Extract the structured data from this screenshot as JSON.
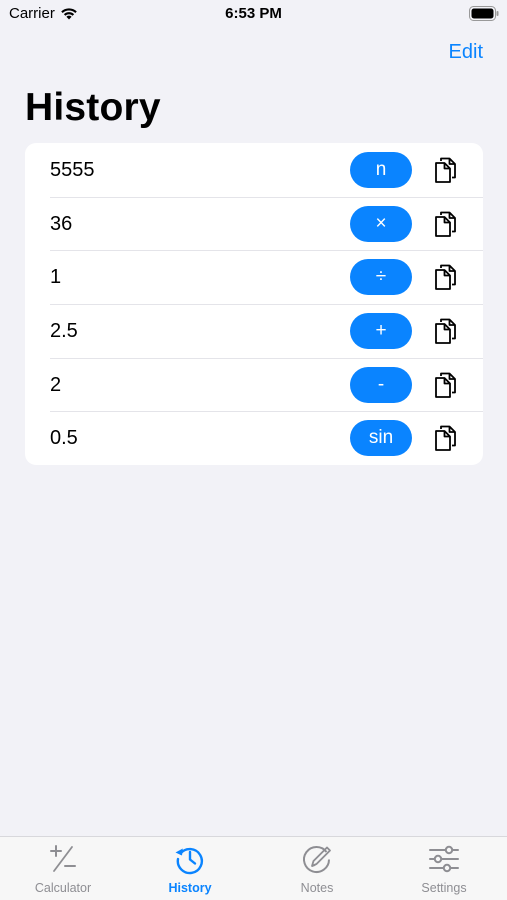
{
  "status": {
    "carrier": "Carrier",
    "time": "6:53 PM"
  },
  "nav": {
    "edit_label": "Edit",
    "title": "History"
  },
  "history": [
    {
      "value": "5555",
      "operation": "n"
    },
    {
      "value": "36",
      "operation": "×"
    },
    {
      "value": "1",
      "operation": "÷"
    },
    {
      "value": "2.5",
      "operation": "+"
    },
    {
      "value": "2",
      "operation": "-"
    },
    {
      "value": "0.5",
      "operation": "sin"
    }
  ],
  "tabs": [
    {
      "label": "Calculator",
      "icon": "plus-minus-icon",
      "active": false
    },
    {
      "label": "History",
      "icon": "history-clock-icon",
      "active": true
    },
    {
      "label": "Notes",
      "icon": "notes-pencil-icon",
      "active": false
    },
    {
      "label": "Settings",
      "icon": "sliders-icon",
      "active": false
    }
  ],
  "colors": {
    "accent": "#0a84ff",
    "background": "#f2f2f7",
    "inactive_tab": "#8e8e93"
  }
}
